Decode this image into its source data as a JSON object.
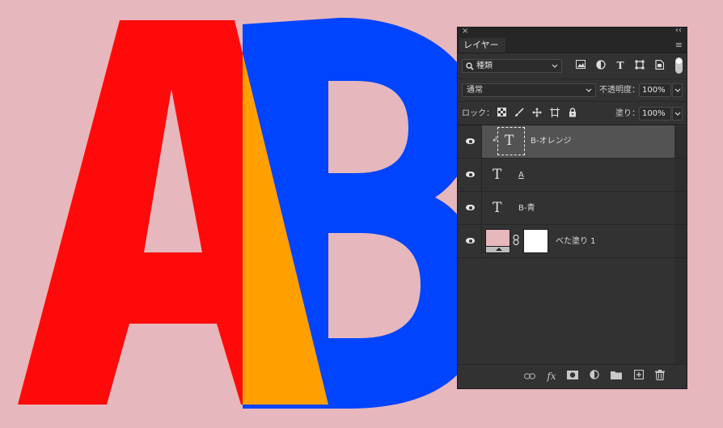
{
  "canvas": {
    "background": "#e6b7bc",
    "letter_a": {
      "text": "A",
      "color": "#ff0a0a"
    },
    "letter_b": {
      "text": "B",
      "color": "#0044ff"
    },
    "overlap_color": "#ffa000"
  },
  "panel": {
    "close_glyph": "×",
    "collapse_glyph": "‹‹",
    "tab_label": "レイヤー",
    "menu_glyph": "≡",
    "filter": {
      "search_glyph": "🔍",
      "kind_label": "種類",
      "chevron": "⌄",
      "icons": [
        "image-filter-icon",
        "adjustment-filter-icon",
        "type-filter-icon",
        "shape-filter-icon",
        "smart-object-filter-icon"
      ]
    },
    "blend_mode": "通常",
    "opacity_label": "不透明度：",
    "opacity_value": "100%",
    "lock_label": "ロック：",
    "fill_label": "塗り：",
    "fill_value": "100%",
    "layers": [
      {
        "name": "B-オレンジ",
        "type": "text",
        "selected": true,
        "clipped": true
      },
      {
        "name": "A",
        "type": "text",
        "selected": false
      },
      {
        "name": "B-青",
        "type": "text",
        "selected": false
      },
      {
        "name": "べた塗り 1",
        "type": "fill",
        "selected": false,
        "fill_color": "#e6b7bc"
      }
    ],
    "type_glyph": "T",
    "clip_glyph": "↲",
    "link_glyph": "🔗",
    "footer_icons": [
      "link-layers-icon",
      "fx-icon",
      "add-mask-icon",
      "new-adjustment-icon",
      "new-group-icon",
      "new-layer-icon",
      "delete-layer-icon"
    ],
    "fx_label": "fx"
  }
}
